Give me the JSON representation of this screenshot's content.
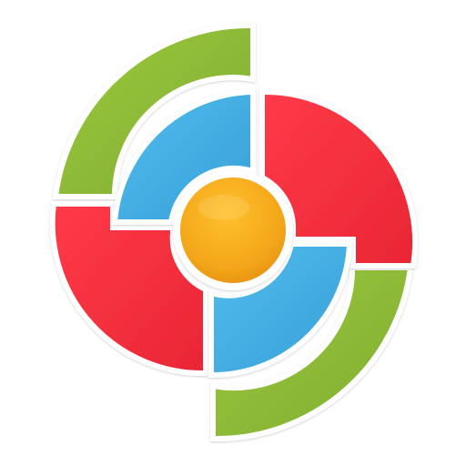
{
  "icon": {
    "name": "pinwheel-logo-icon",
    "colors": {
      "green": "#8fbf3a",
      "red": "#f4303f",
      "blue": "#45b2e6",
      "orange": "#f3a51a",
      "separator": "#ffffff"
    }
  }
}
